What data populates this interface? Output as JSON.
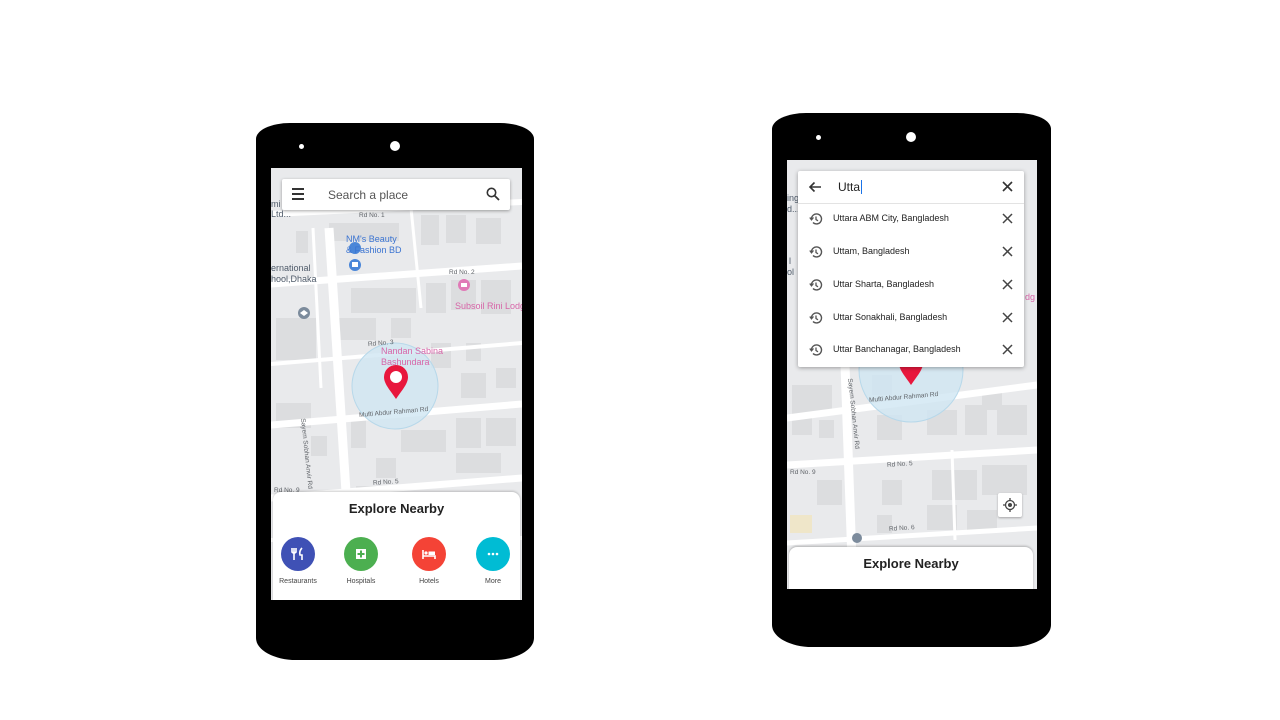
{
  "phone1": {
    "search": {
      "placeholder": "Search a place"
    },
    "map_labels": {
      "rd1": "Rd No. 1",
      "rd2": "Rd No. 2",
      "rd3": "Rd No. 3",
      "rd5": "Rd No. 5",
      "rd9": "Rd No. 9",
      "mufti": "Mufti Abdur Rahman Rd",
      "sayem": "Sayem Sobhan Anvir Rd",
      "nm1": "NM's Beauty",
      "nm2": "& Fashion BD",
      "subsoil": "Subsoil Rini Lodge",
      "nandan1": "Nandan Sabina",
      "nandan2": "Bashundara",
      "intl1": "ernational",
      "intl2": "hool,Dhaka",
      "ltd1": "mi",
      "ltd2": "Ltd..."
    },
    "explore": {
      "title": "Explore Nearby",
      "categories": [
        {
          "label": "Restaurants",
          "color": "#3f51b5",
          "icon": "restaurant-icon"
        },
        {
          "label": "Hospitals",
          "color": "#4caf50",
          "icon": "hospital-icon"
        },
        {
          "label": "Hotels",
          "color": "#f44336",
          "icon": "hotel-icon"
        },
        {
          "label": "More",
          "color": "#00bcd4",
          "icon": "more-icon"
        }
      ]
    }
  },
  "phone2": {
    "query": "Utta",
    "suggestions": [
      "Uttara ABM City, Bangladesh",
      "Uttam, Bangladesh",
      "Uttar Sharta, Bangladesh",
      "Uttar Sonakhali, Bangladesh",
      "Uttar Banchanagar, Bangladesh"
    ],
    "map_labels": {
      "mufti": "Mufti Abdur Rahman Rd",
      "sayem": "Sayem Sobhan Anvir Rd",
      "rd5": "Rd No. 5",
      "rd6": "Rd No. 6",
      "rd9": "Rd No. 9",
      "edge1": "ing",
      "edge2": "d...",
      "edge3": "l",
      "edge4": "ol",
      "edge5": "dg"
    },
    "explore": {
      "title": "Explore Nearby"
    }
  },
  "colors": {
    "marker": "#e8173d",
    "map_bg": "#e9eaec",
    "building": "#dcdddf",
    "road": "#ffffff",
    "radius": "#cfe6f3"
  }
}
